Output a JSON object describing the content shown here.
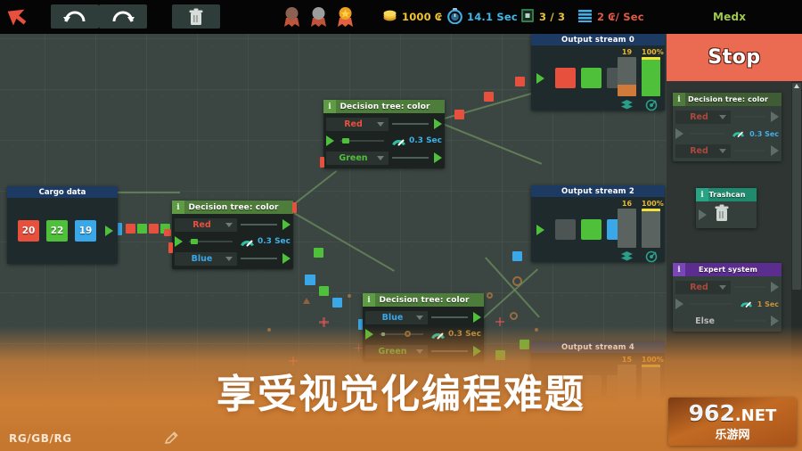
{
  "toolbar": {
    "cursor_icon": "cursor-arrow-icon",
    "undo_label": "undo-icon",
    "redo_label": "redo-icon",
    "trash_label": "trash-icon",
    "medals": [
      "bronze-medal-icon",
      "silver-medal-icon",
      "gold-medal-icon"
    ],
    "stats": [
      {
        "icon": "coin-icon",
        "value": "1000 ₢"
      },
      {
        "icon": "stopwatch-icon",
        "value": "14.1 Sec"
      },
      {
        "icon": "level-icon",
        "value": "3 / 3"
      },
      {
        "icon": "throughput-icon",
        "value": "2 ₢/ Sec"
      }
    ],
    "player_name": "Medx"
  },
  "sidebar": {
    "stop_button": "Stop",
    "palette": [
      {
        "title": "Decision tree: color",
        "info_icon": "info-icon",
        "rows": [
          {
            "value": "Red",
            "color": "red"
          },
          {
            "gauge": "0.3 Sec"
          },
          {
            "value": "Red",
            "color": "red"
          }
        ]
      },
      {
        "title": "Trashcan",
        "info_icon": "info-icon",
        "icon": "trash-icon"
      },
      {
        "title": "Expert system",
        "info_icon": "info-icon",
        "rows": [
          {
            "value": "Red",
            "color": "red"
          },
          {
            "gauge": "1 Sec"
          },
          {
            "value": "Else",
            "color": "else"
          }
        ]
      }
    ]
  },
  "canvas": {
    "cargo": {
      "title": "Cargo data",
      "boxes": [
        {
          "label": "20",
          "color": "red"
        },
        {
          "label": "22",
          "color": "green"
        },
        {
          "label": "19",
          "color": "blue"
        }
      ]
    },
    "nodes": [
      {
        "id": "node-a",
        "title": "Decision tree: color",
        "info_icon": "info-icon",
        "rows": [
          {
            "value": "Red",
            "color": "red"
          },
          {
            "gauge": "0.3 Sec"
          },
          {
            "value": "Green",
            "color": "green"
          }
        ]
      },
      {
        "id": "node-b",
        "title": "Decision tree: color",
        "info_icon": "info-icon",
        "rows": [
          {
            "value": "Red",
            "color": "red"
          },
          {
            "gauge": "0.3 Sec"
          },
          {
            "value": "Blue",
            "color": "blue"
          }
        ]
      },
      {
        "id": "node-c",
        "title": "Decision tree: color",
        "info_icon": "info-icon",
        "rows": [
          {
            "value": "Blue",
            "color": "blue"
          },
          {
            "gauge": "0.3 Sec"
          },
          {
            "value": "Green",
            "color": "green"
          }
        ]
      }
    ],
    "output_streams": [
      {
        "title": "Output stream 0",
        "slots": [
          "red",
          "green",
          "empty"
        ],
        "count": "19",
        "percent": "100%",
        "count_fill": 30,
        "percent_fill": 100,
        "stack_icon": "stack-icon",
        "target_icon": "target-icon"
      },
      {
        "title": "Output stream 2",
        "slots": [
          "empty",
          "green",
          "blue"
        ],
        "count": "16",
        "percent": "100%",
        "count_fill": 0,
        "percent_fill": 0,
        "stack_icon": "stack-icon",
        "target_icon": "target-icon"
      },
      {
        "title": "Output stream 4",
        "slots": [],
        "count": "15",
        "percent": "100%",
        "count_fill": 0,
        "percent_fill": 0,
        "stack_icon": "stack-icon",
        "target_icon": "target-icon"
      }
    ]
  },
  "overlay": {
    "promo_text": "享受视觉化编程难题",
    "status_text": "RG/GB/RG",
    "pencil_icon": "pencil-icon",
    "watermark_main": "962",
    "watermark_net": ".NET",
    "watermark_sub": "乐游网"
  },
  "colors": {
    "red": "#e8503e",
    "green": "#4fc03a",
    "blue": "#39a7e8",
    "accent_stop": "#ea6a52",
    "panel_header": "#4e7d3b",
    "canvas_bg": "#3b4643"
  }
}
